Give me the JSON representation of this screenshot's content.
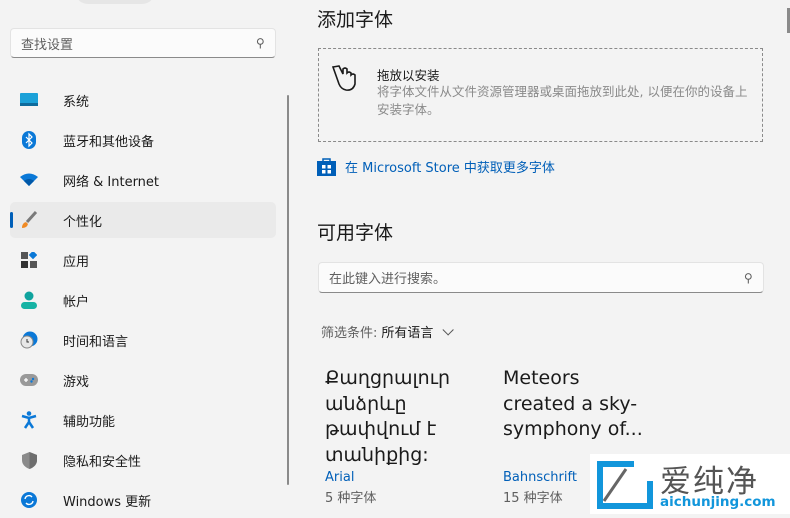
{
  "sidebar": {
    "search_placeholder": "查找设置",
    "items": [
      {
        "label": "系统",
        "icon": "monitor-icon"
      },
      {
        "label": "蓝牙和其他设备",
        "icon": "bluetooth-icon"
      },
      {
        "label": "网络 & Internet",
        "icon": "wifi-icon"
      },
      {
        "label": "个性化",
        "icon": "brush-icon",
        "selected": true
      },
      {
        "label": "应用",
        "icon": "apps-icon"
      },
      {
        "label": "帐户",
        "icon": "person-icon"
      },
      {
        "label": "时间和语言",
        "icon": "clock-globe-icon"
      },
      {
        "label": "游戏",
        "icon": "gamepad-icon"
      },
      {
        "label": "辅助功能",
        "icon": "accessibility-icon"
      },
      {
        "label": "隐私和安全性",
        "icon": "shield-icon"
      },
      {
        "label": "Windows 更新",
        "icon": "sync-icon"
      }
    ]
  },
  "main": {
    "add_title": "添加字体",
    "drop_title": "拖放以安装",
    "drop_desc": "将字体文件从文件资源管理器或桌面拖放到此处, 以便在你的设备上安装字体。",
    "store_link": "在 Microsoft Store 中获取更多字体",
    "available_title": "可用字体",
    "search_placeholder": "在此键入进行搜索。",
    "filter_label": "筛选条件:",
    "filter_value": "所有语言",
    "fonts": [
      {
        "sample": "Քաղցրալուր անձրևը թափվում է տանիքից:",
        "name": "Arial",
        "count": "5 种字体"
      },
      {
        "sample": "Meteors created a sky-symphony of...",
        "name": "Bahnschrift",
        "count": "15 种字体"
      }
    ]
  },
  "watermark": {
    "brand": "爱纯净",
    "url": "aichunjing.com"
  },
  "colors": {
    "accent": "#005fb8",
    "bg": "#f3f3f3"
  }
}
